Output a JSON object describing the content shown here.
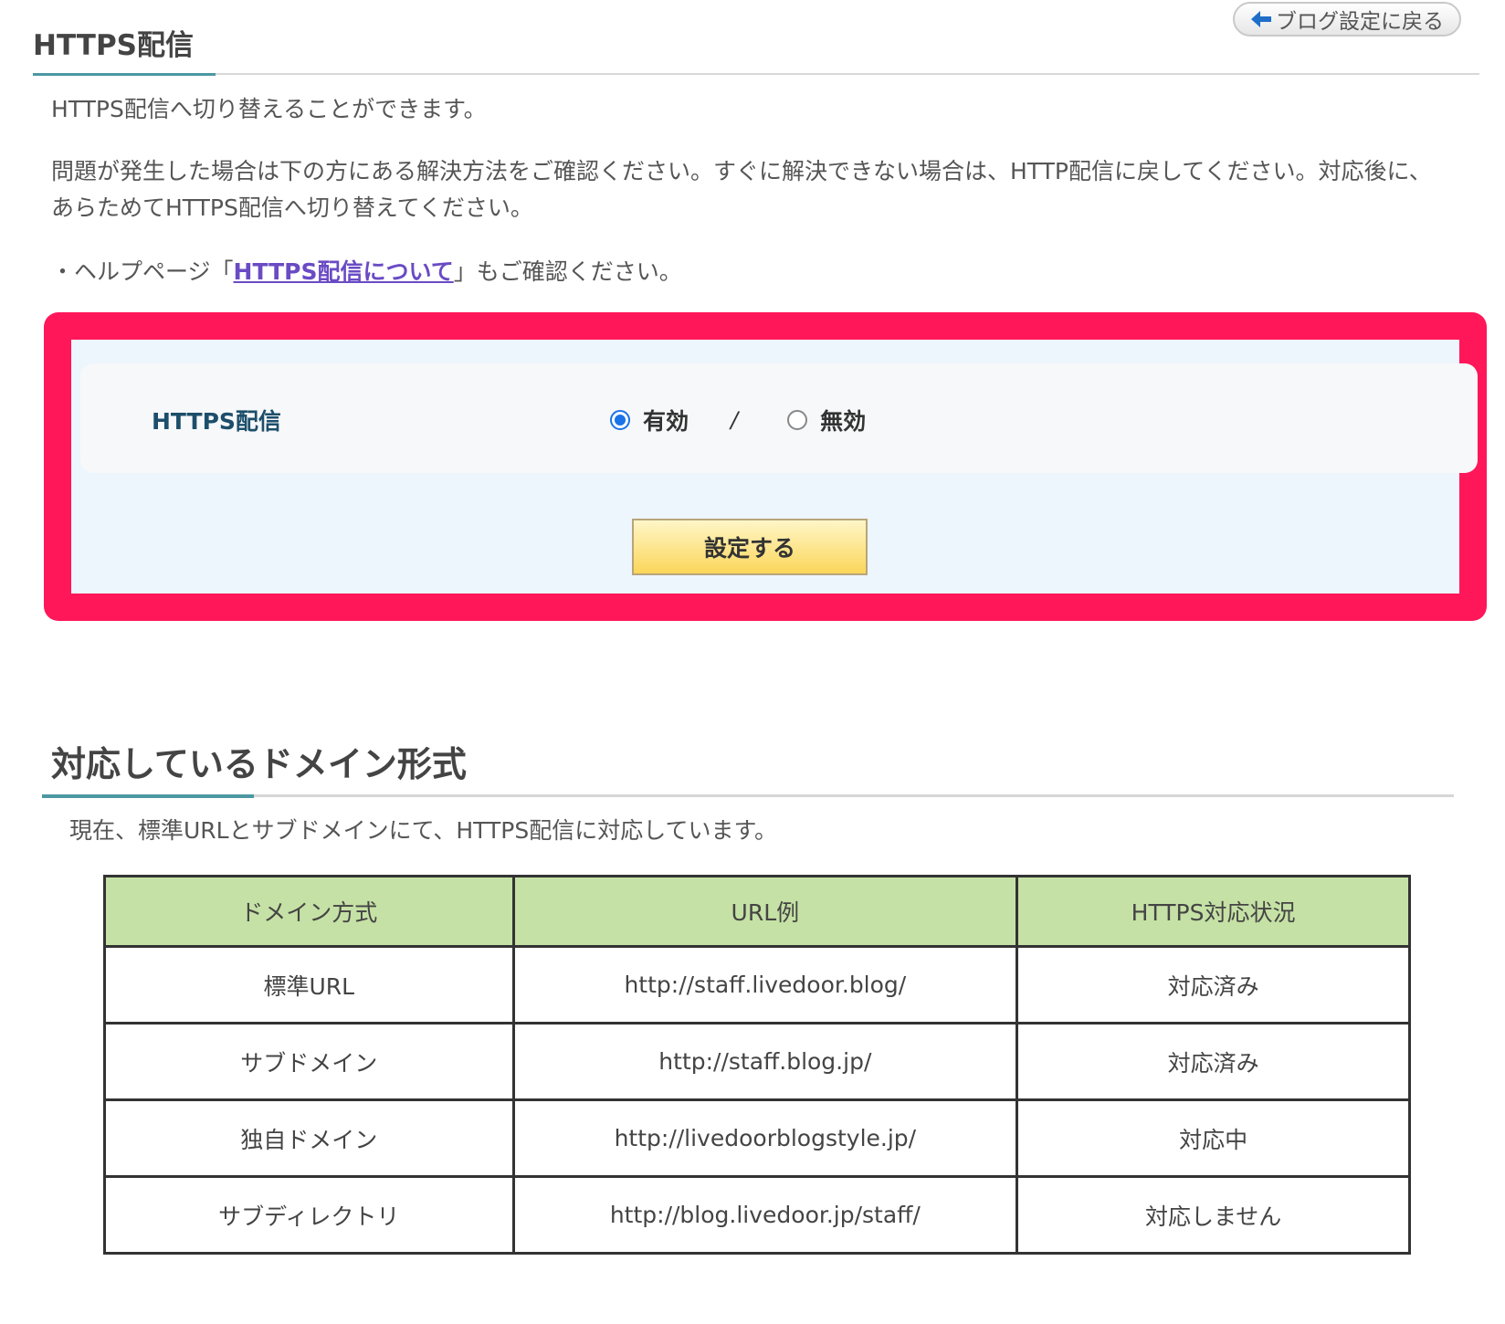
{
  "header": {
    "back_button_label": "ブログ設定に戻る",
    "title": "HTTPS配信"
  },
  "intro": {
    "line1": "HTTPS配信へ切り替えることができます。",
    "line2": "問題が発生した場合は下の方にある解決方法をご確認ください。すぐに解決できない場合は、HTTP配信に戻してください。対応後に、あらためてHTTPS配信へ切り替えてください。",
    "help_prefix": "・ヘルプページ「",
    "help_link": "HTTPS配信について",
    "help_suffix": "」もご確認ください。"
  },
  "settings": {
    "label": "HTTPS配信",
    "options": [
      {
        "label": "有効",
        "checked": true
      },
      {
        "label": "無効",
        "checked": false
      }
    ],
    "separator": "/",
    "submit_label": "設定する"
  },
  "domains": {
    "title": "対応しているドメイン形式",
    "description": "現在、標準URLとサブドメインにて、HTTPS配信に対応しています。",
    "columns": [
      "ドメイン方式",
      "URL例",
      "HTTPS対応状況"
    ],
    "rows": [
      [
        "標準URL",
        "http://staff.livedoor.blog/",
        "対応済み"
      ],
      [
        "サブドメイン",
        "http://staff.blog.jp/",
        "対応済み"
      ],
      [
        "独自ドメイン",
        "http://livedoorblogstyle.jp/",
        "対応中"
      ],
      [
        "サブディレクトリ",
        "http://blog.livedoor.jp/staff/",
        "対応しません"
      ]
    ]
  },
  "colors": {
    "highlight_border": "#ff1759",
    "table_header_bg": "#c5e1a5",
    "accent_rule": "#4c98a2",
    "link": "#6a4bc4",
    "radio_checked": "#1a73e8"
  }
}
